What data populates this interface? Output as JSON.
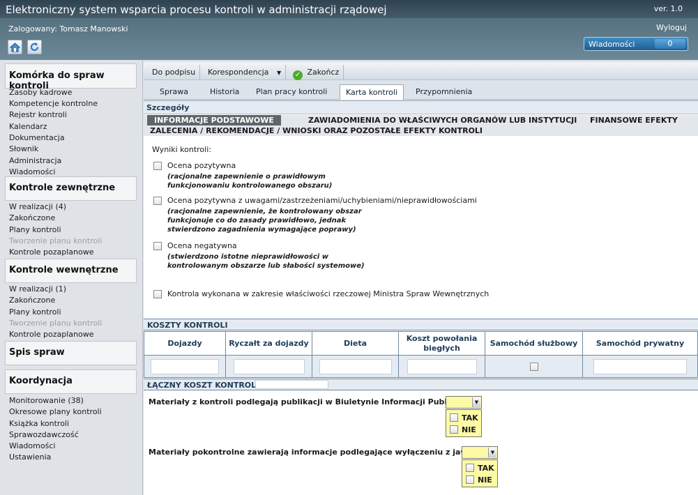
{
  "header": {
    "title": "Elektroniczny system wsparcia procesu kontroli w administracji rządowej",
    "version": "ver. 1.0",
    "logged_in": "Zalogowany: Tomasz Manowski",
    "logout": "Wyloguj",
    "messages_label": "Wiadomości",
    "messages_count": "0"
  },
  "sidebar": {
    "s1": "Komórka do spraw kontroli",
    "s1_items": [
      "Zasoby kadrowe",
      "Kompetencje kontrolne",
      "Rejestr kontroli",
      "Kalendarz",
      "Dokumentacja",
      "Słownik",
      "Administracja",
      "Wiadomości"
    ],
    "s2": "Kontrole zewnętrzne",
    "s2_items": [
      "W realizacji (4)",
      "Zakończone",
      "Plany kontroli",
      "Tworzenie planu kontroli",
      "Kontrole pozaplanowe"
    ],
    "s3": "Kontrole wewnętrzne",
    "s3_items": [
      "W realizacji (1)",
      "Zakończone",
      "Plany kontroli",
      "Tworzenie planu kontroli",
      "Kontrole pozaplanowe"
    ],
    "s4": "Spis spraw",
    "s5": "Koordynacja",
    "s5_items": [
      "Monitorowanie (38)",
      "Okresowe plany kontroli",
      "Książka kontroli",
      "Sprawozdawczość",
      "Wiadomości",
      "Ustawienia"
    ]
  },
  "toolbar": {
    "do_podpisu": "Do podpisu",
    "korespondencja": "Korespondencja",
    "zakoncz": "Zakończ"
  },
  "tabs": [
    "Sprawa",
    "Historia",
    "Plan pracy kontroli",
    "Karta kontroli",
    "Przypomnienia"
  ],
  "details": {
    "header": "Szczegóły",
    "subtab1": "INFORMACJE PODSTAWOWE",
    "subtab2": "ZAWIADOMIENIA DO WŁAŚCIWYCH ORGANÓW LUB INSTYTUCJI",
    "subtab3": "FINANSOWE EFEKTY",
    "subtab4": "ZALECENIA / REKOMENDACJE / WNIOSKI ORAZ POZOSTAŁE EFEKTY KONTROLI"
  },
  "results": {
    "label": "Wyniki kontroli:",
    "opt1": "Ocena pozytywna",
    "opt1_note": [
      "(racjonalne zapewnienie o prawidłowym",
      "funkcjonowaniu kontrolowanego obszaru)"
    ],
    "opt2": "Ocena pozytywna z uwagami/zastrzeżeniami/uchybieniami/nieprawidłowościami",
    "opt2_note": [
      "(racjonalne zapewnienie, że kontrolowany obszar",
      "funkcjonuje co do zasady prawidłowo, jednak",
      "stwierdzono zagadnienia wymagające poprawy)"
    ],
    "opt3": "Ocena negatywna",
    "opt3_note": [
      "(stwierdzono istotne nieprawidłowości w",
      "kontrolowanym obszarze lub słabości systemowe)"
    ],
    "ministry": "Kontrola wykonana w zakresie właściwości rzeczowej Ministra Spraw Wewnętrznych"
  },
  "costs": {
    "header": "KOSZTY KONTROLI",
    "col1": "Dojazdy",
    "col2": "Ryczałt za dojazdy",
    "col3": "Dieta",
    "col4a": "Koszt powołania",
    "col4b": "biegłych",
    "col5": "Samochód służbowy",
    "col6": "Samochód prywatny",
    "total": "ŁĄCZNY KOSZT KONTROLI:"
  },
  "publication": {
    "q1": "Materiały z kontroli podlegają publikacji w Biuletynie Informacji Publicznej:",
    "q2": "Materiały pokontrolne zawierają informacje podlegające wyłączeniu z jawności:",
    "yes": "TAK",
    "no": "NIE"
  }
}
